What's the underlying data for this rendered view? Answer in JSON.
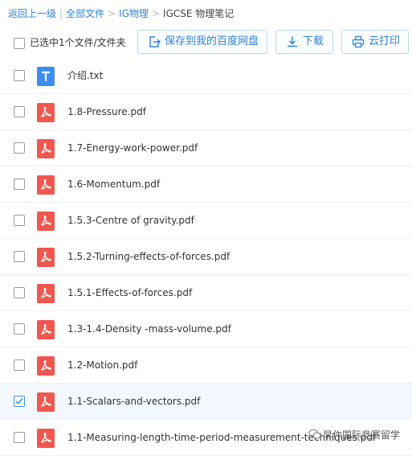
{
  "breadcrumb": {
    "back": "返回上一级",
    "sep1": "|",
    "all_files": "全部文件",
    "sep2": ">",
    "folder1": "IG物理",
    "sep3": ">",
    "current": "IGCSE 物理笔记"
  },
  "toolbar": {
    "selection_label": "已选中1个文件/文件夹",
    "save_label": "保存到我的百度网盘",
    "download_label": "下载",
    "print_label": "云打印"
  },
  "files": [
    {
      "name": "介绍.txt",
      "type": "txt",
      "checked": false
    },
    {
      "name": "1.8-Pressure.pdf",
      "type": "pdf",
      "checked": false
    },
    {
      "name": "1.7-Energy-work-power.pdf",
      "type": "pdf",
      "checked": false
    },
    {
      "name": "1.6-Momentum.pdf",
      "type": "pdf",
      "checked": false
    },
    {
      "name": "1.5.3-Centre of gravity.pdf",
      "type": "pdf",
      "checked": false
    },
    {
      "name": "1.5.2-Turning-effects-of-forces.pdf",
      "type": "pdf",
      "checked": false
    },
    {
      "name": "1.5.1-Effects-of-forces.pdf",
      "type": "pdf",
      "checked": false
    },
    {
      "name": "1.3-1.4-Density -mass-volume.pdf",
      "type": "pdf",
      "checked": false
    },
    {
      "name": "1.2-Motion.pdf",
      "type": "pdf",
      "checked": false
    },
    {
      "name": "1.1-Scalars-and-vectors.pdf",
      "type": "pdf",
      "checked": true
    },
    {
      "name": "1.1-Measuring-length-time-period-measurement-techniques.pdf",
      "type": "pdf",
      "checked": false
    }
  ],
  "watermark": {
    "text": "早作国际竞赛留学"
  },
  "colors": {
    "accent": "#2f83d6",
    "pdf_red": "#f0574f",
    "txt_blue": "#3d8ef0",
    "selected_row": "#f3f8fe"
  }
}
